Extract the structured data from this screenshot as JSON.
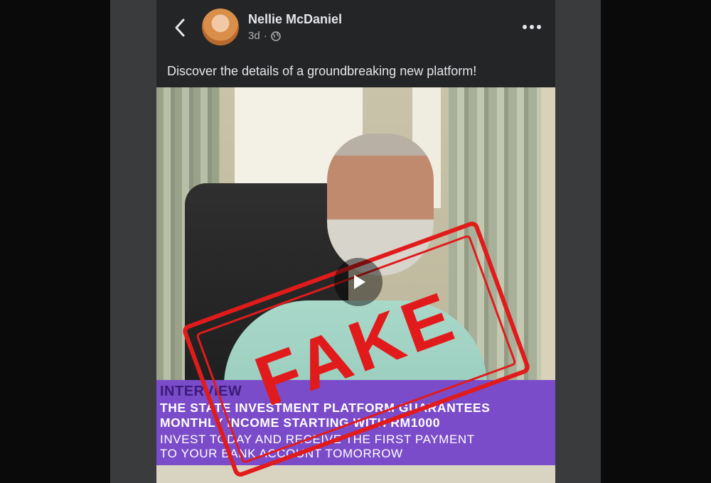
{
  "post": {
    "author": "Nellie McDaniel",
    "time": "3d",
    "privacy_icon": "globe-icon",
    "caption": "Discover the details of a groundbreaking new platform!"
  },
  "video": {
    "stamp_text": "FAKE",
    "banner": {
      "line1": "INTERVIEW",
      "line2": "THE STATE INVESTMENT PLATFORM GUARANTEES",
      "line3": "MONTHLY INCOME STARTING WITH RM1000",
      "line4": "INVEST TODAY AND RECEIVE THE FIRST PAYMENT",
      "line5": "TO YOUR BANK ACCOUNT TOMORROW"
    }
  },
  "colors": {
    "background": "#0a0a0a",
    "post_bg": "#242526",
    "banner": "#7b4cc9",
    "stamp": "#e11b1b"
  }
}
